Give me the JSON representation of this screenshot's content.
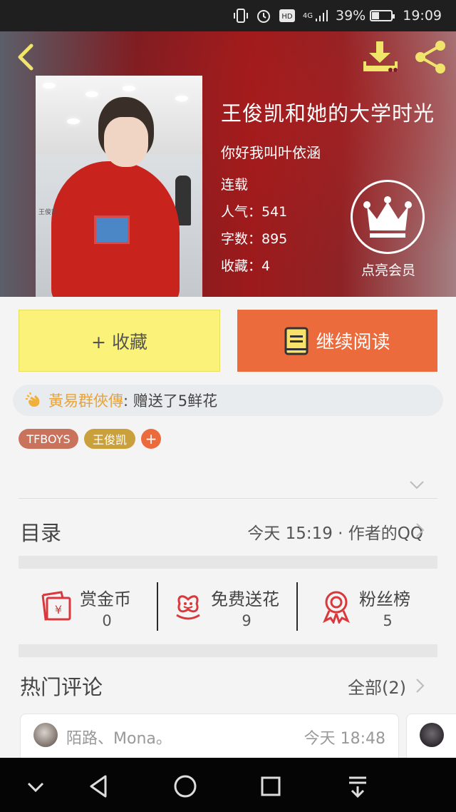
{
  "status_bar": {
    "network": "4G",
    "battery": "39%",
    "time": "19:09"
  },
  "book": {
    "title": "王俊凯和她的大学时光",
    "subtitle": "你好我叫叶依涵",
    "status": "连载",
    "popularity": "人气：541",
    "word_count": "字数：895",
    "favorites": "收藏：4",
    "cover_signature": "王俊凯"
  },
  "vip": {
    "label": "点亮会员"
  },
  "actions": {
    "favorite_label": "+ 收藏",
    "read_label": "继续阅读"
  },
  "gift": {
    "sender": "黃易群俠傳",
    "message": ": 赠送了5鲜花"
  },
  "tags": [
    {
      "label": "TFBOYS",
      "color": "#c9735c"
    },
    {
      "label": "王俊凯",
      "color": "#c9a03c"
    }
  ],
  "tag_add": "+",
  "toc": {
    "label": "目录",
    "meta": "今天 15:19 · 作者的QQ"
  },
  "stats": [
    {
      "label": "赏金币",
      "value": "0",
      "icon": "red-envelope-icon"
    },
    {
      "label": "免费送花",
      "value": "9",
      "icon": "flower-icon"
    },
    {
      "label": "粉丝榜",
      "value": "5",
      "icon": "ribbon-badge-icon"
    }
  ],
  "hot_comments": {
    "label": "热门评论",
    "all_label": "全部(2)"
  },
  "comment": {
    "author": "陌路、Mona。",
    "time": "今天 18:48"
  },
  "colors": {
    "accent_orange": "#ec6b3d",
    "favorite_yellow": "#fbf27a",
    "icon_yellow": "#f0e46a",
    "stat_icon_red": "#d9393c"
  }
}
